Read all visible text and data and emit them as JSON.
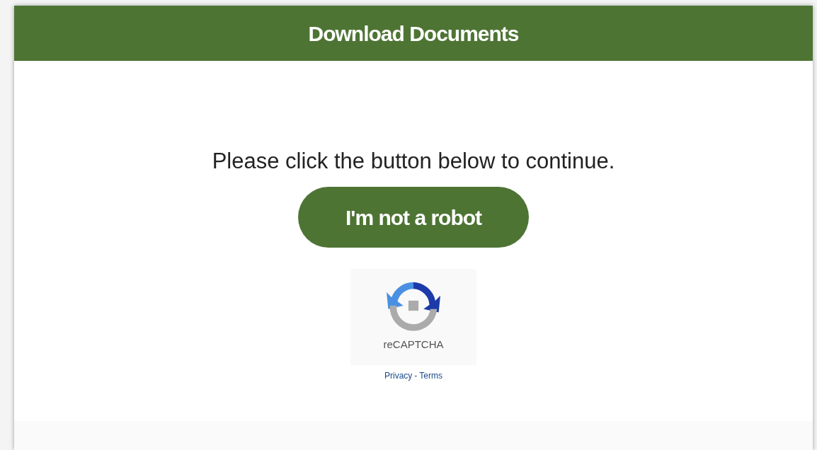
{
  "header": {
    "title": "Download Documents"
  },
  "message": "Please click the button below to continue.",
  "button": {
    "label": "I'm not a robot"
  },
  "recaptcha": {
    "label": "reCAPTCHA",
    "links": [
      "Privacy",
      "Terms"
    ],
    "separator": "-"
  }
}
